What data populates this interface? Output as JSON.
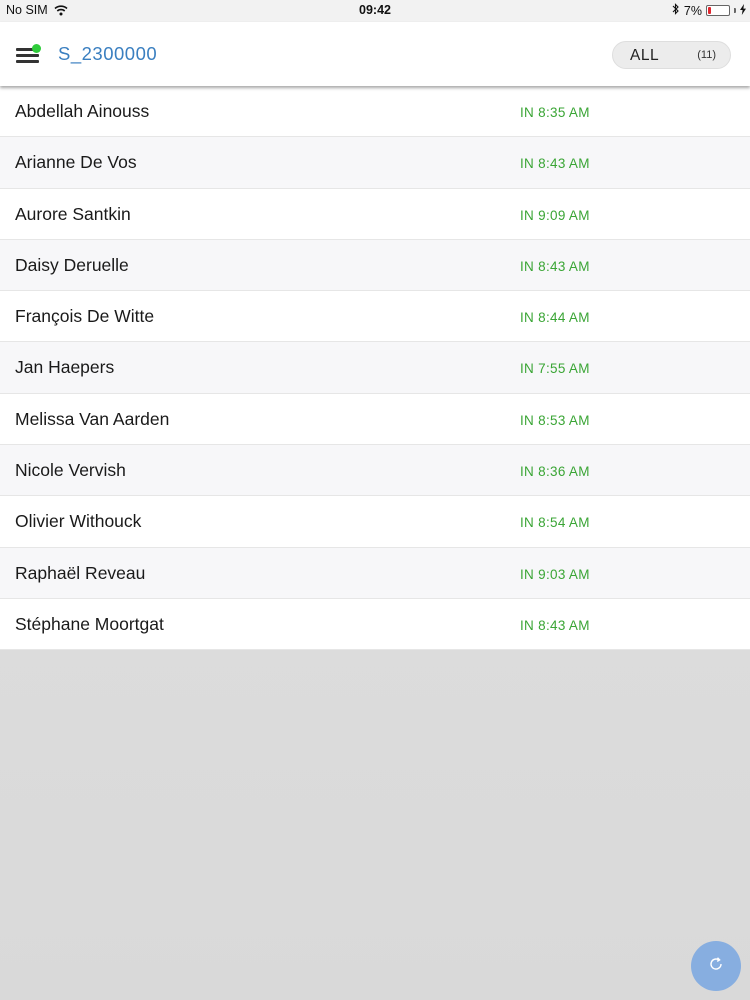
{
  "status_bar": {
    "carrier": "No SIM",
    "time": "09:42",
    "battery": "7%"
  },
  "header": {
    "title": "S_2300000",
    "filter": {
      "label": "ALL",
      "count": "(11)"
    }
  },
  "attendance": [
    {
      "name": "Abdellah Ainouss",
      "status": "IN 8:35 AM"
    },
    {
      "name": "Arianne De Vos",
      "status": "IN 8:43 AM"
    },
    {
      "name": "Aurore Santkin",
      "status": "IN 9:09 AM"
    },
    {
      "name": "Daisy Deruelle",
      "status": "IN 8:43 AM"
    },
    {
      "name": "François De Witte",
      "status": "IN 8:44 AM"
    },
    {
      "name": "Jan Haepers",
      "status": "IN 7:55 AM"
    },
    {
      "name": "Melissa Van Aarden",
      "status": "IN 8:53 AM"
    },
    {
      "name": "Nicole Vervish",
      "status": "IN 8:36 AM"
    },
    {
      "name": "Olivier Withouck",
      "status": "IN 8:54 AM"
    },
    {
      "name": "Raphaël Reveau",
      "status": "IN 9:03 AM"
    },
    {
      "name": "Stéphane Moortgat",
      "status": "IN 8:43 AM"
    }
  ],
  "colors": {
    "title_blue": "#3a7fc0",
    "status_green": "#3aa535",
    "online_dot": "#2fcc3b",
    "refresh_button": "#87aee0"
  },
  "icons": {
    "menu": "hamburger-icon",
    "online": "online-dot-icon",
    "refresh": "refresh-icon",
    "wifi": "wifi-icon",
    "bluetooth": "bluetooth-icon",
    "battery": "battery-icon",
    "charging": "charging-bolt-icon"
  }
}
